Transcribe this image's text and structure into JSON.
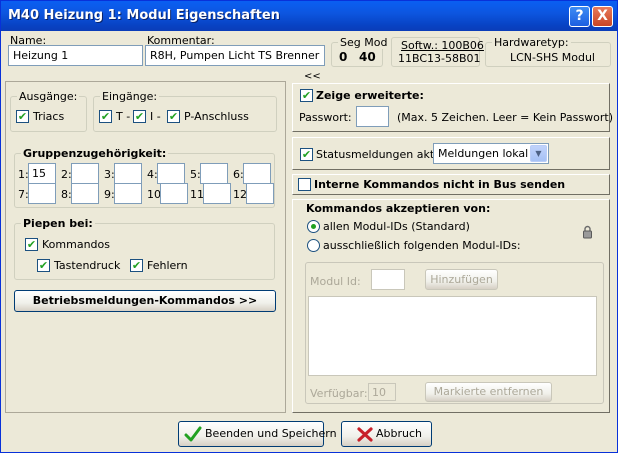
{
  "window": {
    "title": "M40 Heizung 1: Modul Eigenschaften",
    "help_button": "?",
    "close_button": "X"
  },
  "header": {
    "name_label": "Name:",
    "name_value": "Heizung 1",
    "comment_label": "Kommentar:",
    "comment_value": "R8H, Pumpen Licht TS Brenner",
    "segmod_label": "Seg Mod",
    "seg_value": "0",
    "mod_value": "40",
    "softw_label": "Softw.: 100B06",
    "softw_value": "11BC13-58B01",
    "hardware_label": "Hardwaretyp:",
    "hardware_value": "LCN-SHS Modul",
    "collapse_glyph": "<<"
  },
  "left": {
    "outputs_title": "Ausgänge:",
    "outputs_triacs": "Triacs",
    "inputs_title": "Eingänge:",
    "inputs_t": "T -",
    "inputs_i": "I -",
    "inputs_p": "P-Anschluss",
    "groups_title": "Gruppenzugehörigkeit:",
    "groups": [
      {
        "label": "1:",
        "value": "15"
      },
      {
        "label": "2:",
        "value": ""
      },
      {
        "label": "3:",
        "value": ""
      },
      {
        "label": "4:",
        "value": ""
      },
      {
        "label": "5:",
        "value": ""
      },
      {
        "label": "6:",
        "value": ""
      },
      {
        "label": "7:",
        "value": ""
      },
      {
        "label": "8:",
        "value": ""
      },
      {
        "label": "9:",
        "value": ""
      },
      {
        "label": "10:",
        "value": ""
      },
      {
        "label": "11:",
        "value": ""
      },
      {
        "label": "12:",
        "value": ""
      }
    ],
    "beep_title": "Piepen bei:",
    "beep_commands": "Kommandos",
    "beep_key": "Tastendruck",
    "beep_errors": "Fehlern",
    "ops_button": "Betriebsmeldungen-Kommandos >>"
  },
  "right": {
    "show_extended": "Zeige erweiterte:",
    "password_label": "Passwort:",
    "password_value": "",
    "password_hint": "(Max. 5 Zeichen. Leer = Kein Passwort)",
    "status_active": "Statusmeldungen aktiv",
    "status_select": "Meldungen lokal",
    "internal_commands": "Interne Kommandos nicht in Bus senden",
    "accept_title": "Kommandos akzeptieren von:",
    "accept_all": "allen Modul-IDs (Standard)",
    "accept_only": "ausschließlich folgenden Modul-IDs:",
    "module_id_label": "Modul Id:",
    "module_id_value": "",
    "add_button": "Hinzufügen",
    "available_label": "Verfügbar:",
    "available_value": "10",
    "remove_button": "Markierte entfernen"
  },
  "footer": {
    "save_button": "Beenden und Speichern",
    "cancel_button": "Abbruch"
  },
  "colors": {
    "titlebar": "#0a5ff2",
    "check_green": "#21a121",
    "face": "#ece9d8",
    "cancel_x": "#c8202a"
  }
}
